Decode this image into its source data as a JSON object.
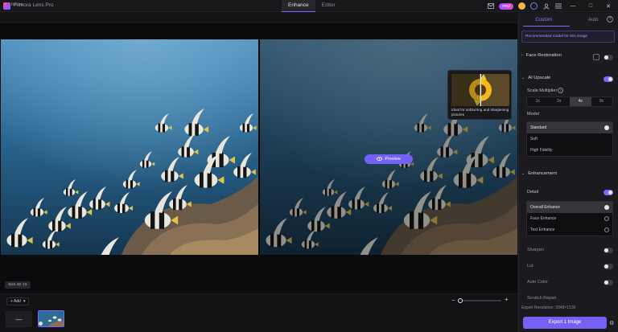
{
  "app": {
    "title": "Filmora Lens Pro",
    "tabs": [
      "Enhance",
      "Editor"
    ],
    "active_tab": 0,
    "pro_label": "PRO"
  },
  "file": {
    "name": "fishes",
    "close": "×",
    "more": "⋮"
  },
  "title_icons": [
    "mail-icon",
    "pro-badge",
    "coin-icon",
    "headset-icon",
    "user-icon",
    "menu-icon"
  ],
  "window": {
    "min": "—",
    "max": "□",
    "close": "✕"
  },
  "canvas": {
    "preview_label": "Preview",
    "size_chip": "Size 4K 1X"
  },
  "tooltip": {
    "text": "Ideal for unblurring and sharpening pictures"
  },
  "bottom": {
    "add_label": "+ Add",
    "add_thumb": "—",
    "zoom_out": "−",
    "zoom_in": "+",
    "zoom_level": 0.1
  },
  "panel": {
    "tabs": [
      "Custom",
      "Auto"
    ],
    "banner": "Recommended model for this image",
    "face_restoration": {
      "label": "Face Restoration",
      "enabled": false
    },
    "ai_upscale": {
      "label": "AI Upscale",
      "enabled": true
    },
    "scale_label": "Scale Multiplier",
    "scales": [
      "1x",
      "2x",
      "4x",
      "8x"
    ],
    "active_scale": 2,
    "model_label": "Model",
    "models": [
      "Standard",
      "Soft",
      "High Fidelity"
    ],
    "active_model": 0,
    "enhancement": {
      "label": "Enhancement"
    },
    "detail": {
      "label": "Detail",
      "enabled": true
    },
    "detail_options": [
      "Overall Enhance",
      "Face Enhance",
      "Text Enhance"
    ],
    "active_detail": 0,
    "sharpen": {
      "label": "Sharpen",
      "enabled": false
    },
    "lut": {
      "label": "Lut",
      "enabled": false
    },
    "auto_color": {
      "label": "Auto Color",
      "enabled": false
    },
    "scratch_repair": {
      "label": "Scratch Repair"
    },
    "reduce_label": "Export Resolution: 2048×1536",
    "export_label": "Export 1 Image"
  }
}
